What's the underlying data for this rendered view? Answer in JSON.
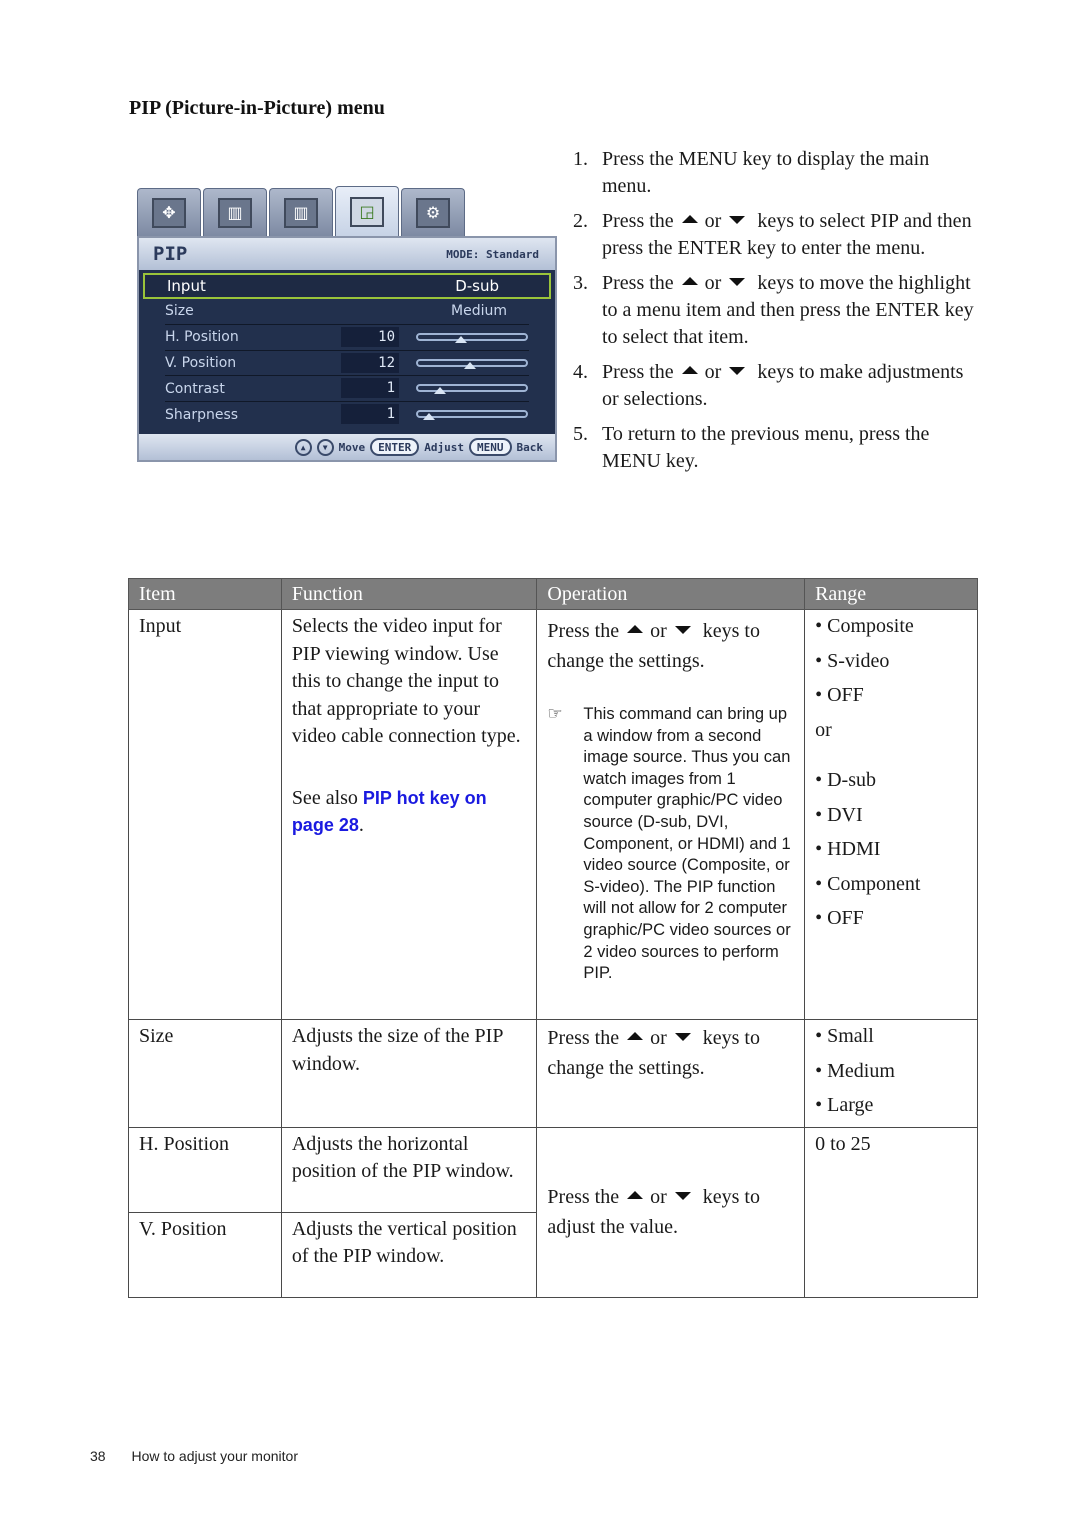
{
  "section_title": "PIP (Picture-in-Picture) menu",
  "osd": {
    "tabs": [
      {
        "icon": "display-adjust-icon",
        "glyph": "✥"
      },
      {
        "icon": "picture-icon",
        "glyph": "▥"
      },
      {
        "icon": "picture-advanced-icon",
        "glyph": "▥"
      },
      {
        "icon": "pip-icon",
        "glyph": "◲"
      },
      {
        "icon": "system-icon",
        "glyph": "⚙"
      }
    ],
    "active_tab": 3,
    "title": "PIP",
    "mode": "MODE: Standard",
    "rows": [
      {
        "label": "Input",
        "value": "D-sub"
      },
      {
        "label": "Size",
        "value": "Medium"
      },
      {
        "label": "H. Position",
        "number": "10",
        "level": 0.4
      },
      {
        "label": "V. Position",
        "number": "12",
        "level": 0.48
      },
      {
        "label": "Contrast",
        "number": "1",
        "level": 0.2
      },
      {
        "label": "Sharpness",
        "number": "1",
        "level": 0.1
      }
    ],
    "footer": {
      "move": "Move",
      "enter": "ENTER",
      "adjust": "Adjust",
      "menu": "MENU",
      "back": "Back"
    }
  },
  "steps": [
    {
      "num": "1.",
      "parts": [
        "Press the ",
        "MENU",
        " key to display the main menu."
      ]
    },
    {
      "num": "2.",
      "pre": "Press the",
      "mid": "or",
      "post": " keys to select PIP and then press the ENTER key to enter the menu."
    },
    {
      "num": "3.",
      "pre": "Press the",
      "mid": "or",
      "post": " keys to move the highlight to a menu item and then press the ENTER key to select that item."
    },
    {
      "num": "4.",
      "pre": "Press the",
      "mid": "or",
      "post": " keys to make adjustments or selections."
    },
    {
      "num": "5.",
      "text": "To return to the previous menu, press the MENU key."
    }
  ],
  "table": {
    "headers": [
      "Item",
      "Function",
      "Operation",
      "Range"
    ],
    "rows": [
      {
        "item": "Input",
        "function": "Selects the video input for PIP viewing window. Use this to change the input to that appropriate to your video cable connection type.",
        "see_also_prefix": "See also ",
        "see_also_link": "PIP hot key on page 28",
        "see_also_suffix": ".",
        "op_pre": "Press the",
        "op_mid": "or",
        "op_post": " keys to change the settings.",
        "note": "This command can bring up a window from a second image source. Thus you can watch images from 1 computer graphic/PC video source (D-sub, DVI, Component, or HDMI) and 1 video source (Composite, or S-video). The PIP function will not allow for 2 computer graphic/PC video sources or 2 video sources to perform PIP.",
        "range_a": [
          "Composite",
          "S-video",
          "OFF"
        ],
        "range_or": "or",
        "range_b": [
          "D-sub",
          "DVI",
          "HDMI",
          "Component",
          "OFF"
        ]
      },
      {
        "item": "Size",
        "function": "Adjusts the size of the PIP window.",
        "op_pre": "Press the",
        "op_mid": "or",
        "op_post": " keys to change the settings.",
        "range": [
          "Small",
          "Medium",
          "Large"
        ]
      },
      {
        "item": "H. Position",
        "function": "Adjusts the horizontal position of the PIP window.",
        "range": "0 to 25"
      },
      {
        "item": "V. Position",
        "function": "Adjusts the vertical position of the PIP window."
      }
    ],
    "shared_op": {
      "pre": "Press the",
      "mid": "or",
      "post": " keys to adjust the value."
    }
  },
  "footer": {
    "page_number": "38",
    "chapter": "How to adjust your monitor"
  }
}
